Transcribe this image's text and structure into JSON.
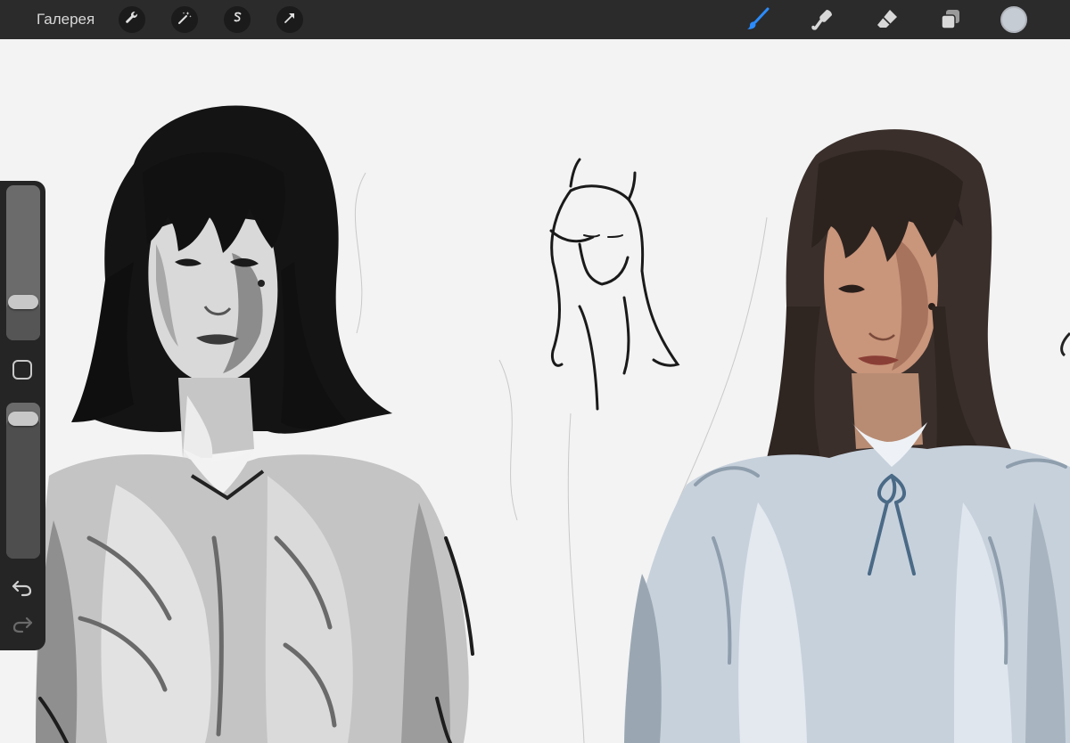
{
  "toolbar": {
    "gallery_label": "Галерея",
    "actions": [
      {
        "icon": "wrench-icon"
      },
      {
        "icon": "magic-wand-icon"
      },
      {
        "icon": "selection-s-icon"
      },
      {
        "icon": "transform-arrow-icon"
      }
    ],
    "tools": [
      {
        "icon": "brush-icon",
        "active": true
      },
      {
        "icon": "smudge-icon",
        "active": false
      },
      {
        "icon": "eraser-icon",
        "active": false
      },
      {
        "icon": "layers-icon",
        "active": false
      }
    ],
    "current_color": "#c6ccd4",
    "active_tool_color": "#2b8cff"
  },
  "sidebar": {
    "size_slider": {
      "value": 0.21,
      "icon": "brush-size-slider"
    },
    "modify_button": {
      "icon": "modify-square-icon"
    },
    "opacity_slider": {
      "value": 0.96,
      "icon": "opacity-slider"
    },
    "undo": {
      "icon": "undo-icon"
    },
    "redo": {
      "icon": "redo-icon"
    }
  },
  "canvas": {
    "background": "#f3f3f3",
    "artworks": [
      {
        "name": "grayscale-portrait"
      },
      {
        "name": "line-sketch"
      },
      {
        "name": "color-portrait"
      }
    ]
  }
}
